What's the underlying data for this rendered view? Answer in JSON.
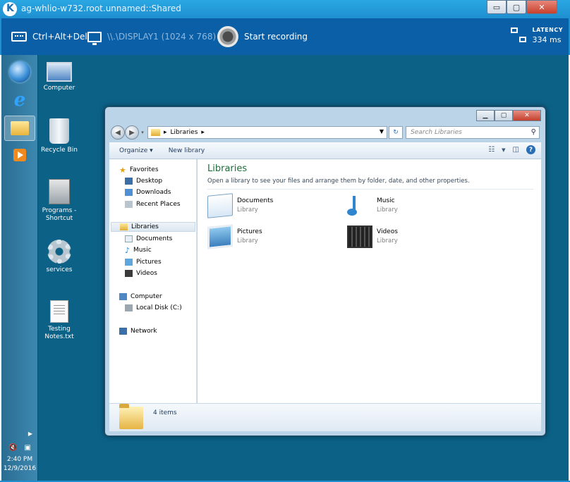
{
  "viewer": {
    "title": "ag-whlio-w732.root.unnamed::Shared",
    "ctrl_alt_del": "Ctrl+Alt+Del",
    "display": "\\\\.\\DISPLAY1 (1024 x 768)",
    "record": "Start recording",
    "latency_label": "LATENCY",
    "latency_value": "334 ms",
    "window_buttons": {
      "minimize": "▭",
      "maximize": "▢",
      "close": "✕"
    }
  },
  "desktop_icons": [
    {
      "label": "Computer",
      "icon": "computer-icon"
    },
    {
      "label": "Recycle Bin",
      "icon": "recycle-bin-icon"
    },
    {
      "label": "Programs -\nShortcut",
      "icon": "programs-icon"
    },
    {
      "label": "services",
      "icon": "services-icon"
    },
    {
      "label": "Testing\nNotes.txt",
      "icon": "text-file-icon"
    }
  ],
  "taskbar": {
    "time": "2:40 PM",
    "date": "12/9/2016"
  },
  "explorer": {
    "address": "Libraries",
    "search_placeholder": "Search Libraries",
    "organize": "Organize ▾",
    "new_library": "New library",
    "nav": {
      "favorites": "Favorites",
      "desktop": "Desktop",
      "downloads": "Downloads",
      "recent_places": "Recent Places",
      "libraries": "Libraries",
      "documents": "Documents",
      "music": "Music",
      "pictures": "Pictures",
      "videos": "Videos",
      "computer": "Computer",
      "local_disk": "Local Disk (C:)",
      "network": "Network"
    },
    "content": {
      "title": "Libraries",
      "description": "Open a library to see your files and arrange them by folder, date, and other properties.",
      "items": [
        {
          "name": "Documents",
          "type": "Library"
        },
        {
          "name": "Music",
          "type": "Library"
        },
        {
          "name": "Pictures",
          "type": "Library"
        },
        {
          "name": "Videos",
          "type": "Library"
        }
      ]
    },
    "status": "4 items"
  }
}
